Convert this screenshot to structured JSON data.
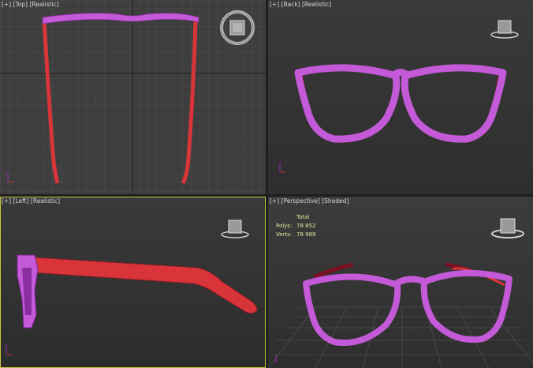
{
  "viewports": {
    "top": {
      "plus": "[+]",
      "name": "[Top]",
      "mode": "[Realistic]"
    },
    "back": {
      "plus": "[+]",
      "name": "[Back]",
      "mode": "[Realistic]"
    },
    "left": {
      "plus": "[+]",
      "name": "[Left]",
      "mode": "[Realistic]"
    },
    "persp": {
      "plus": "[+]",
      "name": "[Perspective]",
      "mode": "[Shaded]"
    }
  },
  "stats": {
    "header": "Total",
    "polys_label": "Polys:",
    "polys_value": "78 852",
    "verts_label": "Verts:",
    "verts_value": "78 989"
  },
  "colors": {
    "frame": "#c45ad8",
    "frame_dark": "#8a2fa0",
    "temple": "#d8343a",
    "viewport_bg": "#3c3c3c",
    "grid": "#5a5a5a",
    "active_border": "#c8c83c"
  },
  "icons": [
    "viewcube-icon",
    "axis-tripod-icon",
    "steering-wheel-icon"
  ]
}
